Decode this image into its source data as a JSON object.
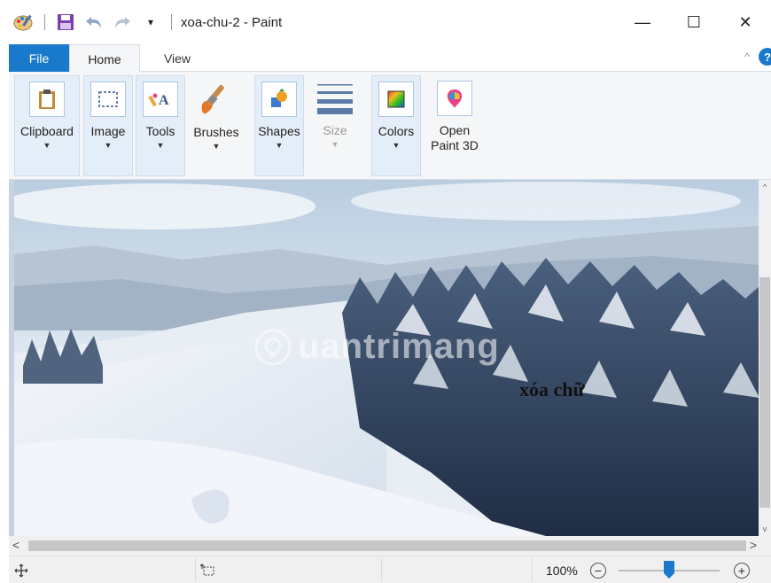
{
  "window": {
    "title": "xoa-chu-2 - Paint",
    "controls": {
      "minimize": "—",
      "maximize": "☐",
      "close": "✕"
    }
  },
  "qat": {
    "customize_glyph": "▾"
  },
  "tabs": [
    {
      "label": "File",
      "active": false
    },
    {
      "label": "Home",
      "active": true
    },
    {
      "label": "View",
      "active": false
    }
  ],
  "ribbon": {
    "groups": [
      {
        "label": "Clipboard",
        "icon": "clipboard-icon",
        "has_dropdown": true
      },
      {
        "label": "Image",
        "icon": "select-icon",
        "has_dropdown": true
      },
      {
        "label": "Tools",
        "icon": "tools-icon",
        "has_dropdown": true
      },
      {
        "label": "Brushes",
        "icon": "brush-icon",
        "has_dropdown": true
      },
      {
        "label": "Shapes",
        "icon": "shapes-icon",
        "has_dropdown": true
      },
      {
        "label": "Size",
        "icon": "size-icon",
        "has_dropdown": true,
        "disabled": true
      },
      {
        "label": "Colors",
        "icon": "colors-icon",
        "has_dropdown": true
      },
      {
        "label_line1": "Open",
        "label_line2": "Paint 3D",
        "icon": "paint3d-icon"
      }
    ],
    "help_label": "?",
    "collapse_glyph": "^"
  },
  "canvas": {
    "overlay_text": "xóa chữ",
    "watermark_text": "uantrimang"
  },
  "scroll": {
    "left_arrow": "<",
    "right_arrow": ">",
    "up_arrow": "^",
    "down_arrow": "v"
  },
  "status": {
    "zoom_percent": "100%",
    "zoom_out": "−",
    "zoom_in": "+",
    "zoom_level": 0.5
  },
  "colors": {
    "accent": "#1979ca",
    "ribbon_bg": "#f5f6f7",
    "group_highlight": "#e4eef8",
    "status_bg": "#f0f0f0"
  }
}
